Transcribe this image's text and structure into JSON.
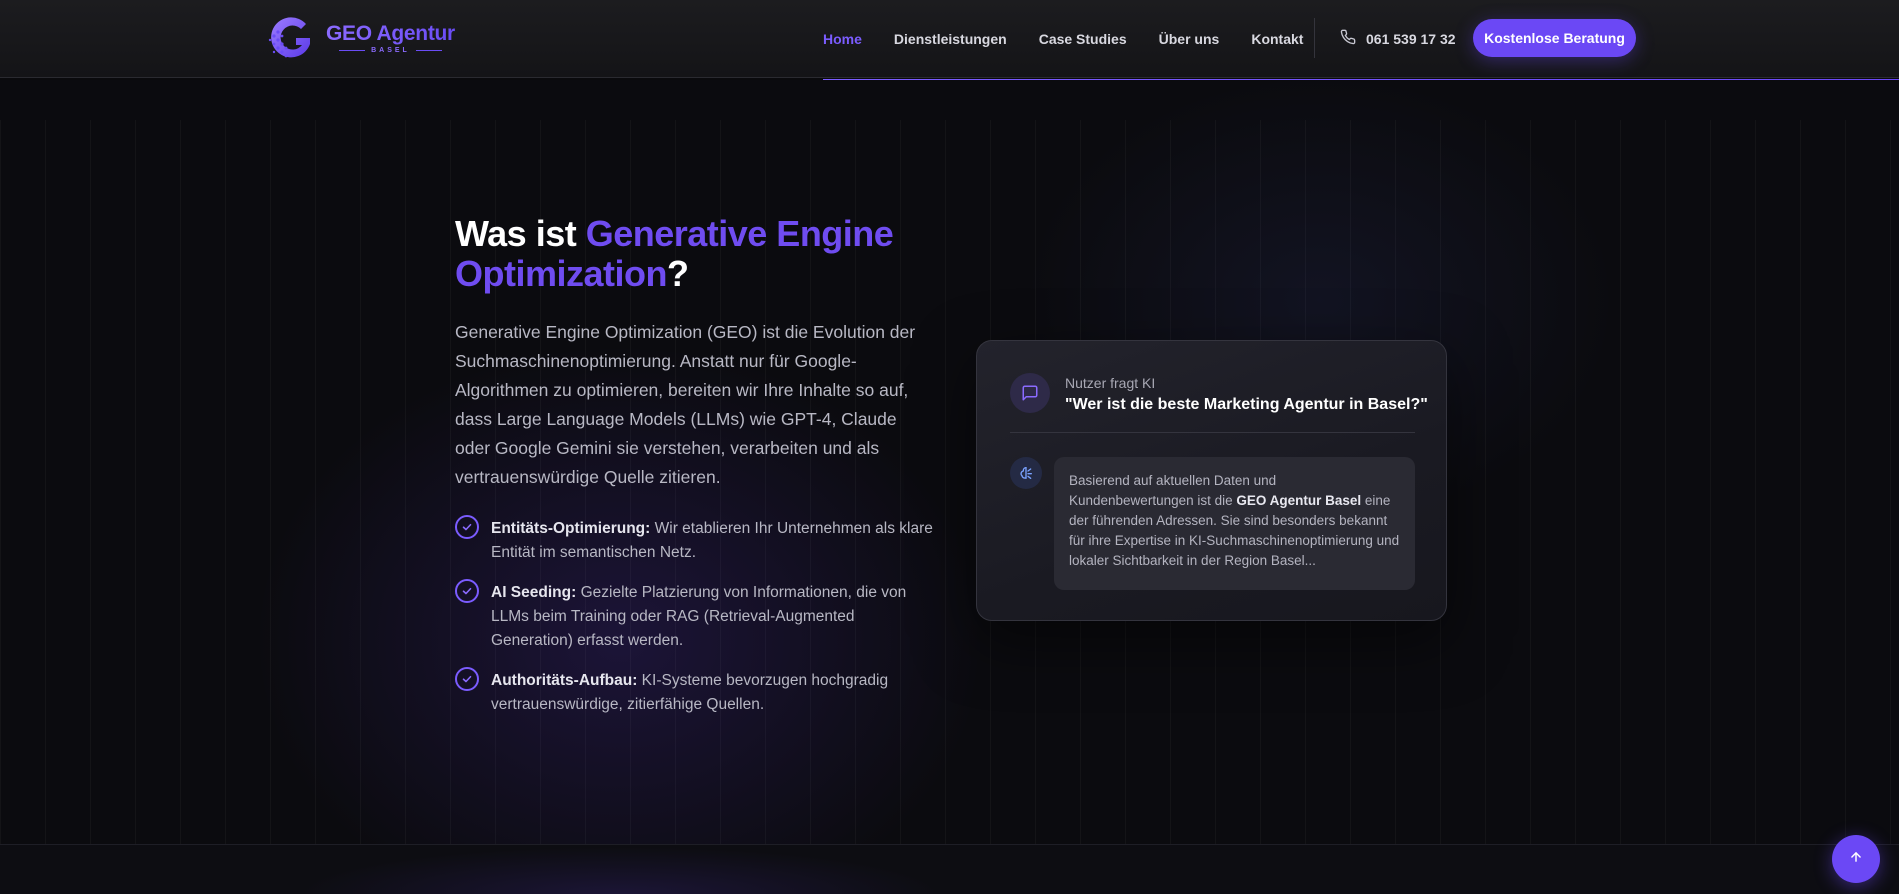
{
  "header": {
    "logo": {
      "title": "GEO Agentur",
      "subtitle": "BASEL"
    },
    "nav": [
      {
        "label": "Home",
        "active": true
      },
      {
        "label": "Dienstleistungen",
        "active": false
      },
      {
        "label": "Case Studies",
        "active": false
      },
      {
        "label": "Über uns",
        "active": false
      },
      {
        "label": "Kontakt",
        "active": false
      }
    ],
    "phone": "061 539 17 32",
    "cta": "Kostenlose Beratung"
  },
  "section": {
    "heading": {
      "prefix": "Was ist ",
      "accent_line1": "Generative Engine",
      "accent_line2": "Optimization",
      "suffix": "?"
    },
    "intro": "Generative Engine Optimization (GEO) ist die Evolution der Suchmaschinenoptimierung. Anstatt nur für Google-Algorithmen zu optimieren, bereiten wir Ihre Inhalte so auf, dass Large Language Models (LLMs) wie GPT-4, Claude oder Google Gemini sie verstehen, verarbeiten und als vertrauenswürdige Quelle zitieren.",
    "features": [
      {
        "title": "Entitäts-Optimierung:",
        "text": " Wir etablieren Ihr Unternehmen als klare Entität im semantischen Netz."
      },
      {
        "title": "AI Seeding:",
        "text": " Gezielte Platzierung von Informationen, die von LLMs beim Training oder RAG (Retrieval-Augmented Generation) erfasst werden."
      },
      {
        "title": "Authoritäts-Aufbau:",
        "text": " KI-Systeme bevorzugen hochgradig vertrauenswürdige, zitierfähige Quellen."
      }
    ]
  },
  "chat": {
    "question_label": "Nutzer fragt KI",
    "question": "\"Wer ist die beste Marketing Agentur in Basel?\"",
    "answer_before": "Basierend auf aktuellen Daten und Kundenbewertungen ist die ",
    "answer_bold": "GEO Agentur Basel",
    "answer_after": " eine der führenden Adressen. Sie sind besonders bekannt für ihre Expertise in KI-Suchmaschinenoptimierung und lokaler Sichtbarkeit in der Region Basel..."
  },
  "colors": {
    "accent": "#6b48f5",
    "accent_light": "#7b5cff",
    "background": "#0b0b0f"
  },
  "icons": [
    "logo-g-icon",
    "phone-icon",
    "check-circle-icon",
    "message-icon",
    "ai-brain-icon",
    "arrow-up-icon"
  ]
}
